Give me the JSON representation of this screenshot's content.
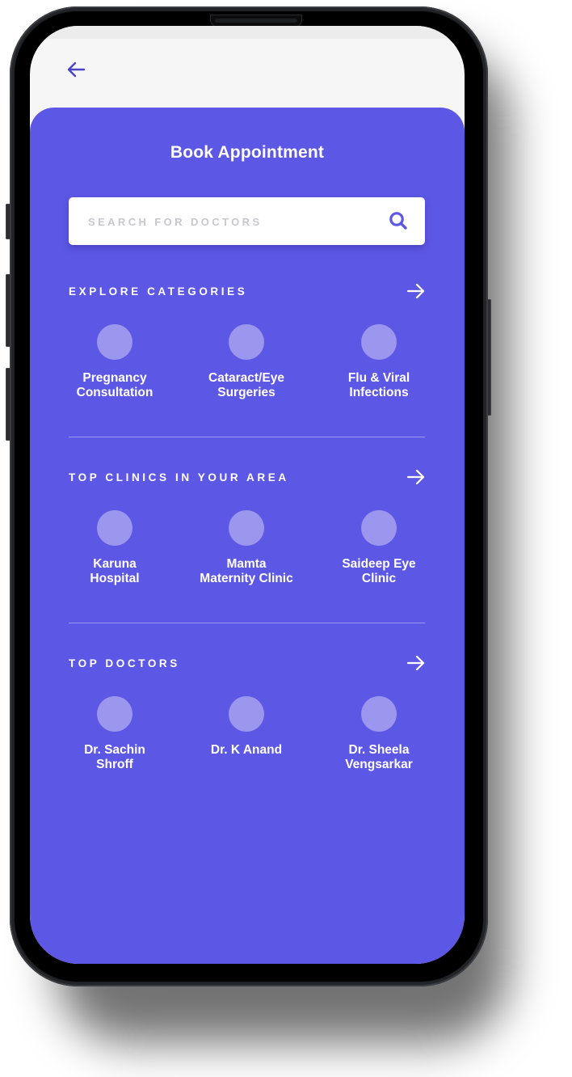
{
  "header": {
    "back_icon": "arrow-left-icon",
    "title": "Book Appointment"
  },
  "search": {
    "placeholder": "SEARCH FOR DOCTORS",
    "value": "",
    "icon": "search-icon"
  },
  "colors": {
    "primary": "#5d57e5",
    "accent_dark": "#4a43c9",
    "placeholder_circle": "#9b96ee",
    "screen_bg": "#f6f6f6"
  },
  "sections": [
    {
      "title": "EXPLORE CATEGORIES",
      "arrow_icon": "arrow-right-icon",
      "items": [
        {
          "label": "Pregnancy\nConsultation"
        },
        {
          "label": "Cataract/Eye\nSurgeries"
        },
        {
          "label": "Flu & Viral\nInfections"
        }
      ]
    },
    {
      "title": "TOP CLINICS IN YOUR AREA",
      "arrow_icon": "arrow-right-icon",
      "items": [
        {
          "label": "Karuna\nHospital"
        },
        {
          "label": "Mamta\nMaternity Clinic"
        },
        {
          "label": "Saideep Eye\nClinic"
        }
      ]
    },
    {
      "title": "TOP DOCTORS",
      "arrow_icon": "arrow-right-icon",
      "items": [
        {
          "label": "Dr. Sachin\nShroff"
        },
        {
          "label": "Dr. K Anand"
        },
        {
          "label": "Dr. Sheela\nVengsarkar"
        }
      ]
    }
  ]
}
